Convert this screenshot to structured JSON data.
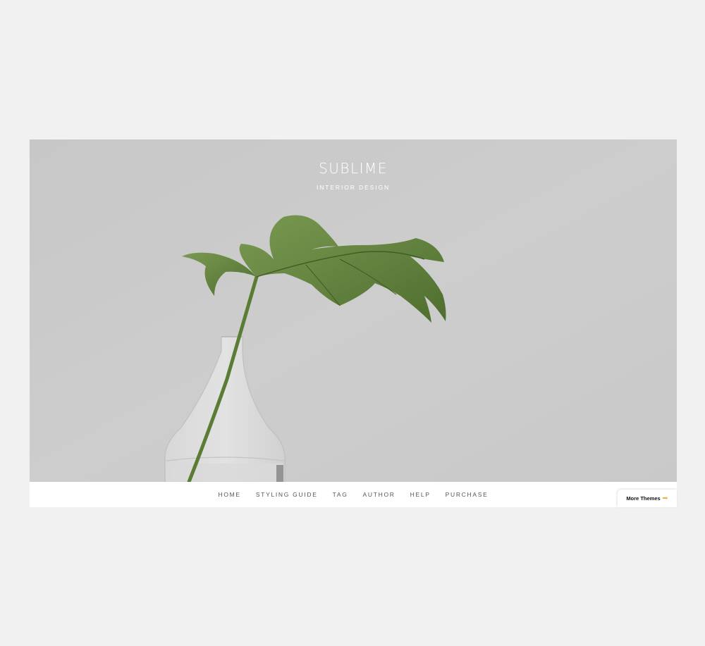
{
  "header": {
    "title": "SUBLIME",
    "tagline": "INTERIOR DESIGN"
  },
  "nav": {
    "items": [
      {
        "label": "HOME"
      },
      {
        "label": "STYLING GUIDE"
      },
      {
        "label": "TAG"
      },
      {
        "label": "AUTHOR"
      },
      {
        "label": "HELP"
      },
      {
        "label": "PURCHASE"
      }
    ]
  },
  "more_themes": {
    "label": "More Themes",
    "icon": "pointing-hand-icon"
  },
  "colors": {
    "page_background": "#f1f1f1",
    "hero_background": "#cbcbcb",
    "leaf_green": "#5f7f3a",
    "nav_text": "#555555"
  }
}
